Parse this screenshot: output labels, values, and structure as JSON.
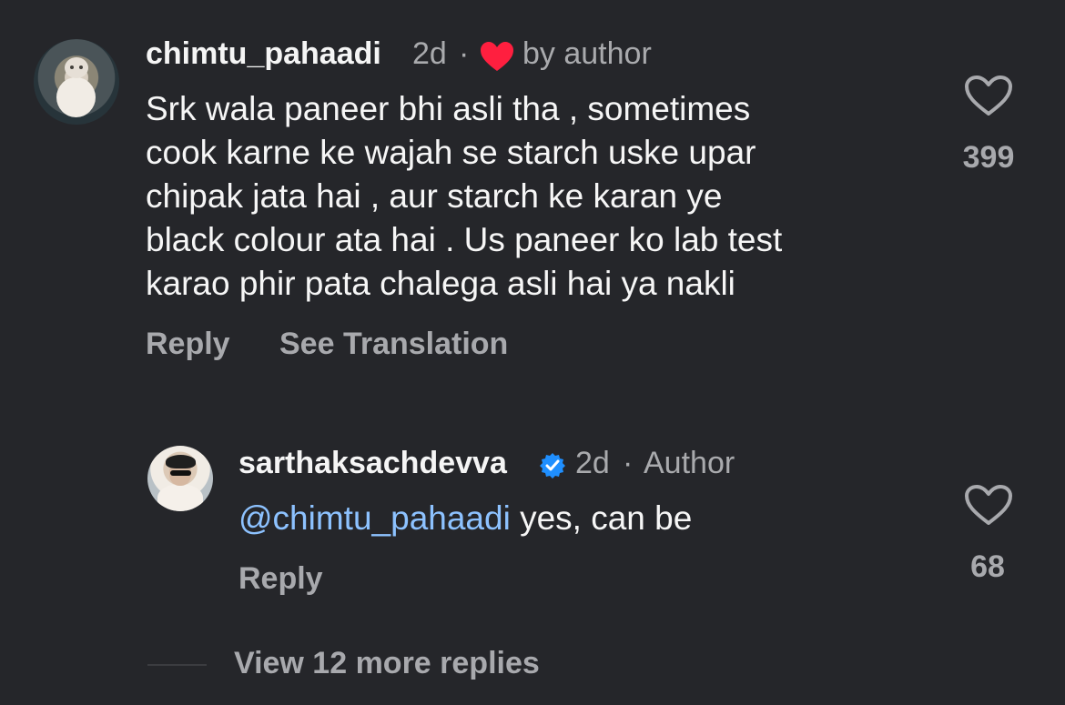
{
  "comments": [
    {
      "username": "chimtu_pahaadi",
      "time": "2d",
      "separator": "·",
      "author_badge": "by author",
      "body": "Srk wala paneer bhi asli tha , sometimes\ncook karne ke wajah se starch uske upar\nchipak jata hai , aur starch ke karan ye\nblack colour ata hai . Us paneer ko lab test\nkarao phir pata chalega asli hai ya nakli",
      "actions": {
        "reply": "Reply",
        "translate": "See Translation"
      },
      "likes": "399",
      "icons": {
        "like": "heart-outline-icon",
        "author_like": "red-heart-icon"
      }
    },
    {
      "username": "sarthaksachdevva",
      "verified_icon": "verified-badge-icon",
      "time": "2d",
      "separator": "·",
      "author_label": "Author",
      "mention": "@chimtu_pahaadi",
      "body": " yes, can be",
      "actions": {
        "reply": "Reply"
      },
      "likes": "68",
      "icons": {
        "like": "heart-outline-icon"
      }
    }
  ],
  "view_more": "View 12 more replies",
  "colors": {
    "background": "#25262a",
    "muted": "#a8a9ad",
    "text": "#f5f5f5",
    "mention": "#8dc2ff",
    "heart_red": "#ff1f3f",
    "verified_blue": "#1f8fff"
  }
}
